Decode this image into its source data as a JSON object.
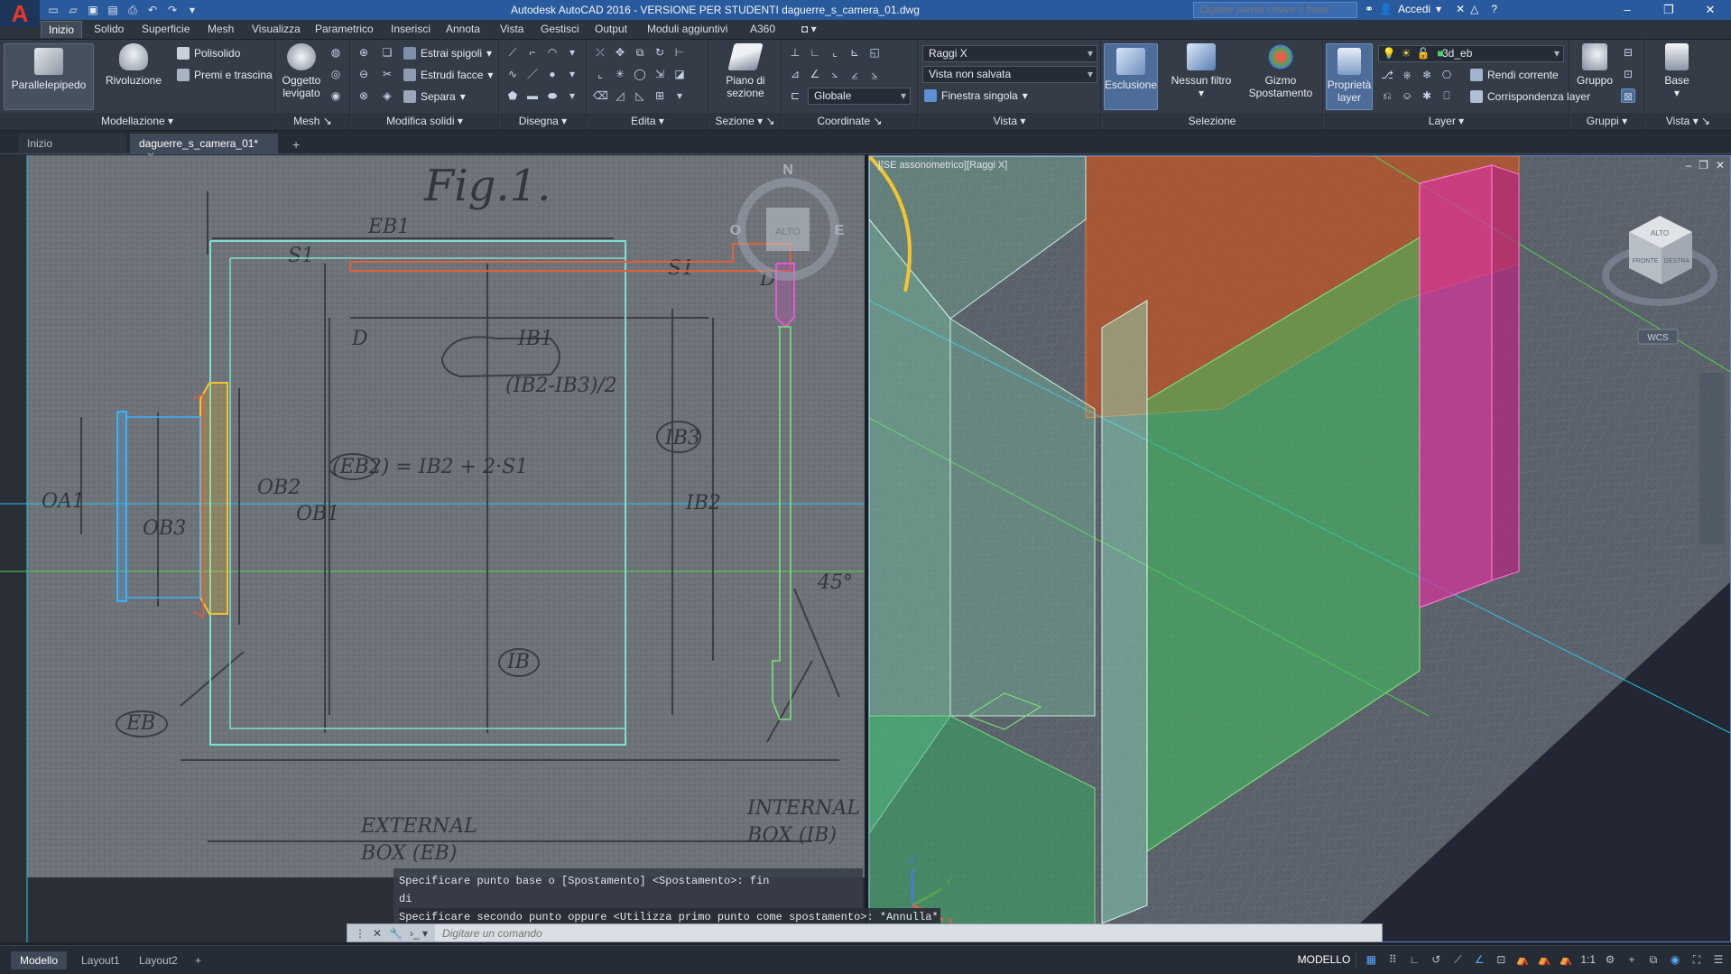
{
  "title_bar": {
    "title": "Autodesk AutoCAD 2016 - VERSIONE PER STUDENTI    daguerre_s_camera_01.dwg",
    "search_placeholder": "Digitare parola chiave o frase",
    "signin": "Accedi",
    "app_logo": "A"
  },
  "ribbon_tabs": [
    "Inizio",
    "Solido",
    "Superficie",
    "Mesh",
    "Visualizza",
    "Parametrico",
    "Inserisci",
    "Annota",
    "Vista",
    "Gestisci",
    "Output",
    "Moduli aggiuntivi",
    "A360"
  ],
  "ribbon": {
    "modellazione": {
      "title": "Modellazione",
      "parallelepipedo": "Parallelepipedo",
      "rivoluzione": "Rivoluzione",
      "polisolido": "Polisolido",
      "premi_trascina": "Premi e trascina"
    },
    "mesh": {
      "title": "Mesh",
      "oggetto_levigato_1": "Oggetto",
      "oggetto_levigato_2": "levigato"
    },
    "modifica_solidi": {
      "title": "Modifica solidi",
      "estrai_spigoli": "Estrai spigoli",
      "estrudi_facce": "Estrudi facce",
      "separa": "Separa"
    },
    "disegna": {
      "title": "Disegna"
    },
    "edita": {
      "title": "Edita"
    },
    "sezione": {
      "title": "Sezione",
      "piano_1": "Piano di",
      "piano_2": "sezione"
    },
    "coordinate": {
      "title": "Coordinate",
      "globale": "Globale"
    },
    "vista": {
      "title": "Vista",
      "stile": "Raggi X",
      "vista_salvata": "Vista non salvata",
      "finestra": "Finestra singola"
    },
    "selezione": {
      "title": "Selezione",
      "esclusione": "Esclusione",
      "nessun_filtro": "Nessun filtro",
      "gizmo_1": "Gizmo",
      "gizmo_2": "Spostamento"
    },
    "layer": {
      "title": "Layer",
      "proprieta_1": "Proprietà",
      "proprieta_2": "layer",
      "current_layer": "3d_eb",
      "rendi_corrente": "Rendi corrente",
      "corrispondenza": "Corrispondenza layer"
    },
    "gruppi": {
      "title": "Gruppi",
      "gruppo": "Gruppo"
    },
    "vista2": {
      "title": "Vista",
      "base": "Base"
    }
  },
  "file_tabs": [
    {
      "label": "Inizio"
    },
    {
      "label": "daguerre_s_camera_01*"
    }
  ],
  "viewport_right": {
    "label": "-][SE assonometrico][Raggi X]",
    "viewcube": {
      "top": "ALTO",
      "front": "FRONTE",
      "right": "DESTRA",
      "wcs": "WCS"
    }
  },
  "compass_left": {
    "n": "N",
    "e": "E",
    "o": "O",
    "top": "ALTO"
  },
  "command": {
    "history": [
      "Specificare punto base o [Spostamento] <Spostamento>: fin",
      "di",
      "Specificare secondo punto oppure <Utilizza primo punto come spostamento>: *Annulla*"
    ],
    "placeholder": "Digitare un comando"
  },
  "layout_tabs": [
    "Modello",
    "Layout1",
    "Layout2"
  ],
  "status": {
    "space": "MODELLO",
    "scale": "1:1"
  },
  "colors": {
    "accent": "#2a5a9e",
    "xray_green": "#4fd27a",
    "xray_pink": "#d9339c",
    "xray_orange": "#c45222",
    "cyan_line": "#28c5e6"
  }
}
